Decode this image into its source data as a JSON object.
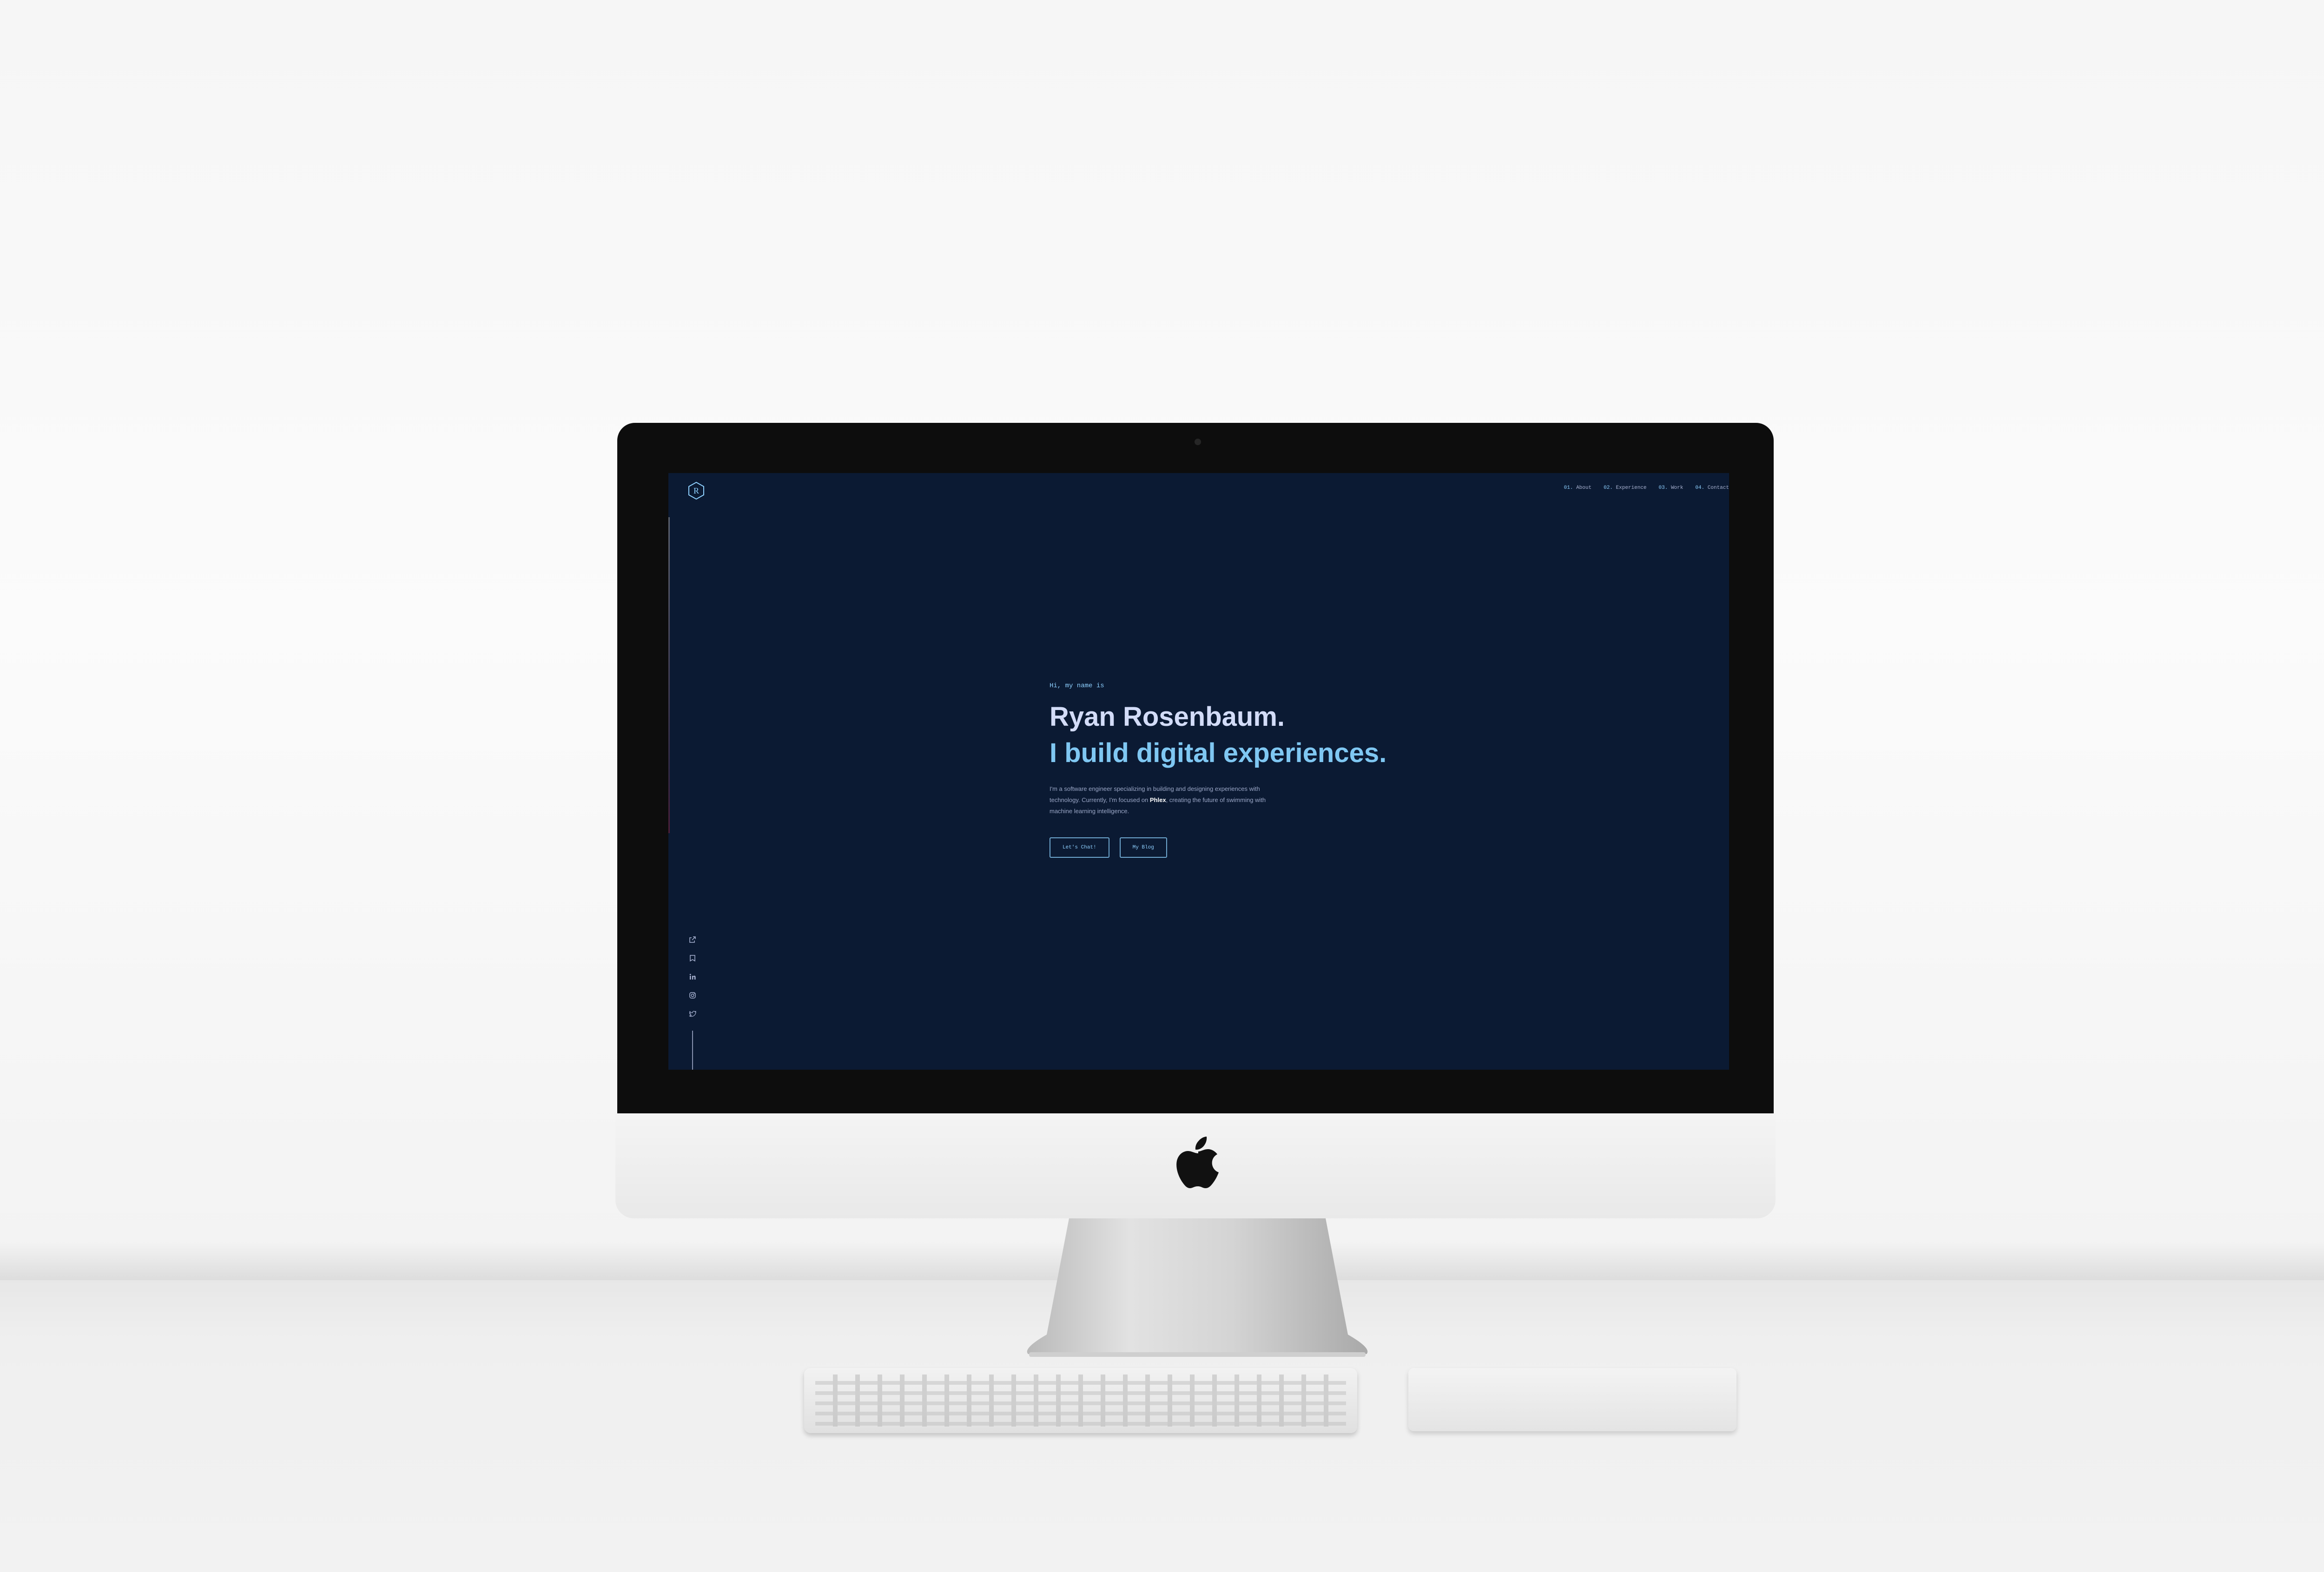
{
  "site": {
    "logo_letter": "R",
    "nav": [
      {
        "num": "01.",
        "label": "About"
      },
      {
        "num": "02.",
        "label": "Experience"
      },
      {
        "num": "03.",
        "label": "Work"
      },
      {
        "num": "04.",
        "label": "Contact"
      }
    ],
    "hero": {
      "greeting": "Hi, my name is",
      "name": "Ryan Rosenbaum.",
      "tagline": "I build digital experiences.",
      "description_before": "I'm a software engineer specializing in building and designing experiences with technology. Currently, I'm focused on ",
      "company": "Phlex",
      "description_after": ", creating the future of swimming with machine learning intelligence.",
      "primary_button": "Let's Chat!",
      "secondary_button": "My Blog"
    },
    "socials": [
      "external-link-icon",
      "bookmark-icon",
      "linkedin-icon",
      "instagram-icon",
      "twitter-icon"
    ]
  },
  "colors": {
    "background": "#0b1a33",
    "accent": "#8ed0ff",
    "heading": "#d3dcf8",
    "tagline": "#7fc7f2"
  }
}
